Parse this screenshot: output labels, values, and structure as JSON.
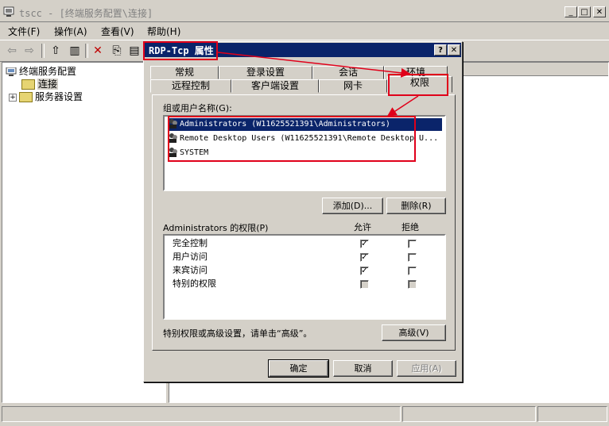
{
  "window": {
    "title": "tscc - [终端服务配置\\连接]",
    "controls": {
      "minimize": "_",
      "maximize": "□",
      "close": "✕"
    }
  },
  "menu": [
    {
      "label": "文件(F)"
    },
    {
      "label": "操作(A)"
    },
    {
      "label": "查看(V)"
    },
    {
      "label": "帮助(H)"
    }
  ],
  "toolbar": {
    "icons": [
      "back-arrow-icon",
      "forward-arrow-icon",
      "up-folder-icon",
      "show-hide-tree-icon",
      "delete-icon",
      "properties-icon",
      "export-list-icon"
    ],
    "glyphs": {
      "back": "⇦",
      "forward": "⇨",
      "up": "⇧",
      "tree": "▥",
      "delete": "✕",
      "properties": "⎘",
      "export": "▤"
    }
  },
  "tree": {
    "root": "终端服务配置",
    "items": [
      {
        "label": "连接",
        "selected": true
      },
      {
        "label": "服务器设置",
        "expand": "+"
      }
    ]
  },
  "dialog": {
    "title": "RDP-Tcp 属性",
    "help_btn": "?",
    "close_btn": "✕",
    "tabs_row1": [
      "常规",
      "登录设置",
      "会话",
      "环境"
    ],
    "tabs_row2": [
      "远程控制",
      "客户端设置",
      "网卡",
      "权限"
    ],
    "active_tab": "权限",
    "group_label": "组或用户名称(G):",
    "users": [
      {
        "name": "Administrators (W11625521391\\Administrators)",
        "selected": true
      },
      {
        "name": "Remote Desktop Users (W11625521391\\Remote Desktop U...",
        "selected": false
      },
      {
        "name": "SYSTEM",
        "selected": false
      }
    ],
    "add_btn": "添加(D)...",
    "remove_btn": "删除(R)",
    "perm_label": "Administrators 的权限(P)",
    "allow_header": "允许",
    "deny_header": "拒绝",
    "permissions": [
      {
        "name": "完全控制",
        "allow": true,
        "deny": false,
        "disabled": false
      },
      {
        "name": "用户访问",
        "allow": true,
        "deny": false,
        "disabled": false
      },
      {
        "name": "来宾访问",
        "allow": true,
        "deny": false,
        "disabled": false
      },
      {
        "name": "特别的权限",
        "allow": false,
        "deny": false,
        "disabled": true
      }
    ],
    "advanced_hint": "特别权限或高级设置，请单击“高级”。",
    "advanced_btn": "高级(V)",
    "ok_btn": "确定",
    "cancel_btn": "取消",
    "apply_btn": "应用(A)"
  },
  "colors": {
    "annotation": "#e0001a",
    "titlebar_active": "#0a246a",
    "face": "#d4d0c8"
  }
}
